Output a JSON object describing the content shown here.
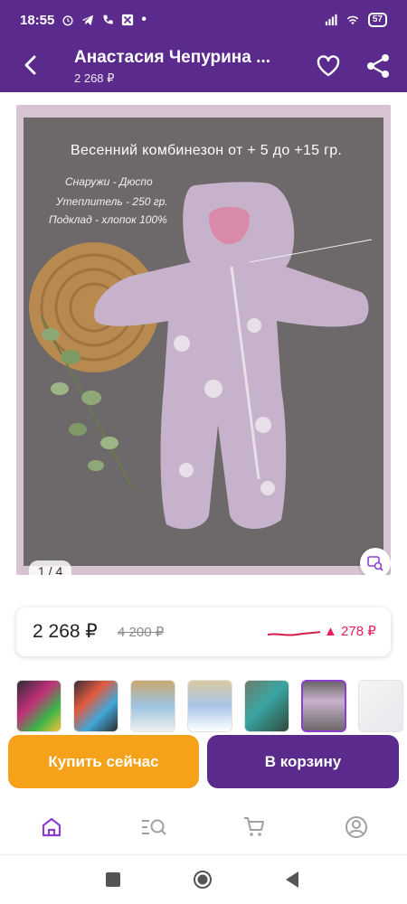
{
  "status": {
    "time": "18:55",
    "battery": "57"
  },
  "header": {
    "title": "Анастасия Чепурина ...",
    "subtitle": "2 268 ₽"
  },
  "gallery": {
    "overlay_title": "Весенний комбинезон от + 5 до +15 гр.",
    "overlay_lines": [
      "Снаружи - Дюспо",
      "Утеплитель - 250 гр.",
      "Подклад - хлопок 100%"
    ],
    "counter": "1 / 4"
  },
  "price": {
    "current": "2 268 ₽",
    "old": "4 200 ₽",
    "delta": "▲ 278 ₽",
    "delta_color": "#e6205a"
  },
  "thumbnails": {
    "count": 7,
    "selected_index": 5
  },
  "actions": {
    "buy_now": "Купить сейчас",
    "add_to_cart": "В корзину"
  },
  "colors": {
    "brand_purple": "#5a2a8c",
    "buy_orange": "#f5a21a",
    "active_tab": "#8b3fd1"
  },
  "tabbar": {
    "items": [
      "home-icon",
      "catalog-search-icon",
      "cart-icon",
      "profile-icon"
    ],
    "active": "home-icon"
  }
}
